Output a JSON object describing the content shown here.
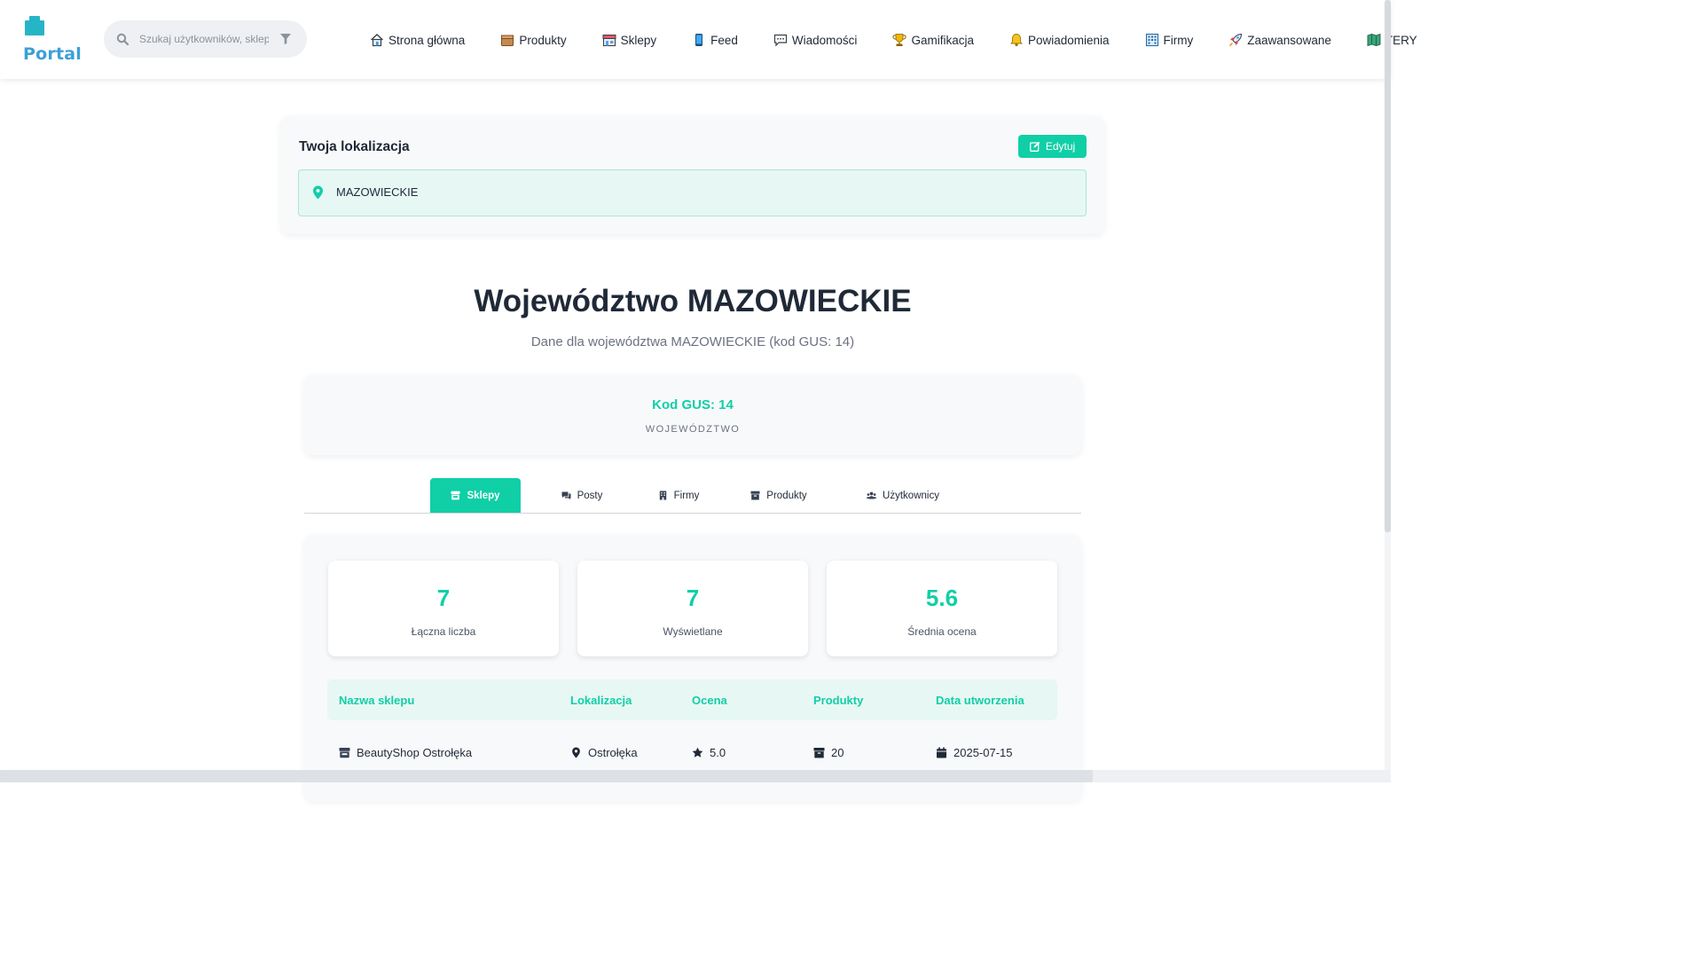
{
  "app": {
    "logo_text": "Portal",
    "accent_color": "#10cfa6"
  },
  "search": {
    "placeholder": "Szukaj użytkowników, sklep"
  },
  "nav": {
    "items": [
      {
        "label": "Strona główna",
        "icon": "home-icon"
      },
      {
        "label": "Produkty",
        "icon": "box-icon"
      },
      {
        "label": "Sklepy",
        "icon": "store-icon"
      },
      {
        "label": "Feed",
        "icon": "phone-icon"
      },
      {
        "label": "Wiadomości",
        "icon": "chat-icon"
      },
      {
        "label": "Gamifikacja",
        "icon": "trophy-icon"
      },
      {
        "label": "Powiadomienia",
        "icon": "bell-icon"
      },
      {
        "label": "Firmy",
        "icon": "building-icon"
      },
      {
        "label": "Zaawansowane",
        "icon": "rocket-icon"
      },
      {
        "label": "TERY",
        "icon": "map-icon"
      }
    ]
  },
  "location": {
    "title": "Twoja lokalizacja",
    "edit_label": "Edytuj",
    "value": "MAZOWIECKIE"
  },
  "page": {
    "title": "Województwo MAZOWIECKIE",
    "subtitle": "Dane dla województwa MAZOWIECKIE (kod GUS: 14)"
  },
  "gus": {
    "value": "Kod GUS: 14",
    "label": "WOJEWÓDZTWO"
  },
  "tabs": [
    {
      "label": "Sklepy",
      "active": true
    },
    {
      "label": "Posty",
      "active": false
    },
    {
      "label": "Firmy",
      "active": false
    },
    {
      "label": "Produkty",
      "active": false
    },
    {
      "label": "Użytkownicy",
      "active": false
    }
  ],
  "stats": [
    {
      "value": "7",
      "label": "Łączna liczba"
    },
    {
      "value": "7",
      "label": "Wyświetlane"
    },
    {
      "value": "5.6",
      "label": "Średnia ocena"
    }
  ],
  "table": {
    "headers": [
      "Nazwa sklepu",
      "Lokalizacja",
      "Ocena",
      "Produkty",
      "Data utworzenia"
    ],
    "rows": [
      {
        "name": "BeautyShop Ostrołęka",
        "location": "Ostrołęka",
        "rating": "5.0",
        "products": "20",
        "created": "2025-07-15"
      }
    ]
  }
}
